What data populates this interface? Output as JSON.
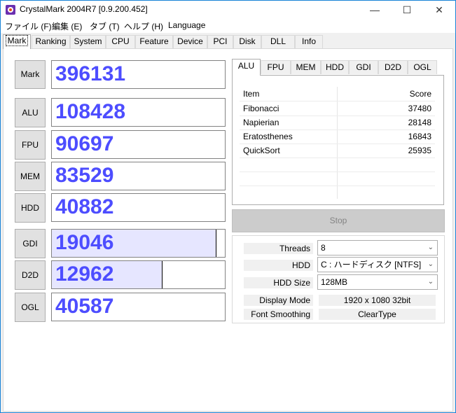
{
  "window": {
    "title": "CrystalMark 2004R7 [0.9.200.452]"
  },
  "menu": [
    "ファイル (F)",
    "編集 (E)",
    "タブ (T)",
    "ヘルプ (H)",
    "Language"
  ],
  "main_tabs": [
    "Mark",
    "Ranking",
    "System",
    "CPU",
    "Feature",
    "Device",
    "PCI",
    "Disk",
    "DLL",
    "Info"
  ],
  "scores": {
    "mark": {
      "label": "Mark",
      "value": "396131"
    },
    "alu": {
      "label": "ALU",
      "value": "108428"
    },
    "fpu": {
      "label": "FPU",
      "value": "90697"
    },
    "mem": {
      "label": "MEM",
      "value": "83529"
    },
    "hdd": {
      "label": "HDD",
      "value": "40882"
    },
    "gdi": {
      "label": "GDI",
      "value": "19046",
      "fill": 0.95
    },
    "d2d": {
      "label": "D2D",
      "value": "12962",
      "fill": 0.64
    },
    "ogl": {
      "label": "OGL",
      "value": "40587"
    }
  },
  "sub_tabs": [
    "ALU",
    "FPU",
    "MEM",
    "HDD",
    "GDI",
    "D2D",
    "OGL"
  ],
  "table": {
    "headers": {
      "item": "Item",
      "score": "Score"
    },
    "rows": [
      {
        "item": "Fibonacci",
        "score": "37480"
      },
      {
        "item": "Napierian",
        "score": "28148"
      },
      {
        "item": "Eratosthenes",
        "score": "16843"
      },
      {
        "item": "QuickSort",
        "score": "25935"
      }
    ]
  },
  "stop_label": "Stop",
  "settings": {
    "threads_label": "Threads",
    "threads_value": "8",
    "hdd_label": "HDD",
    "hdd_value": "C : ハードディスク [NTFS]",
    "hddsize_label": "HDD Size",
    "hddsize_value": "128MB",
    "display_label": "Display Mode",
    "display_value": "1920 x 1080 32bit",
    "font_label": "Font Smoothing",
    "font_value": "ClearType"
  },
  "colors": {
    "score_text": "#4d4dff",
    "bar_fill": "#e6e6ff",
    "accent": "#1883d7"
  }
}
